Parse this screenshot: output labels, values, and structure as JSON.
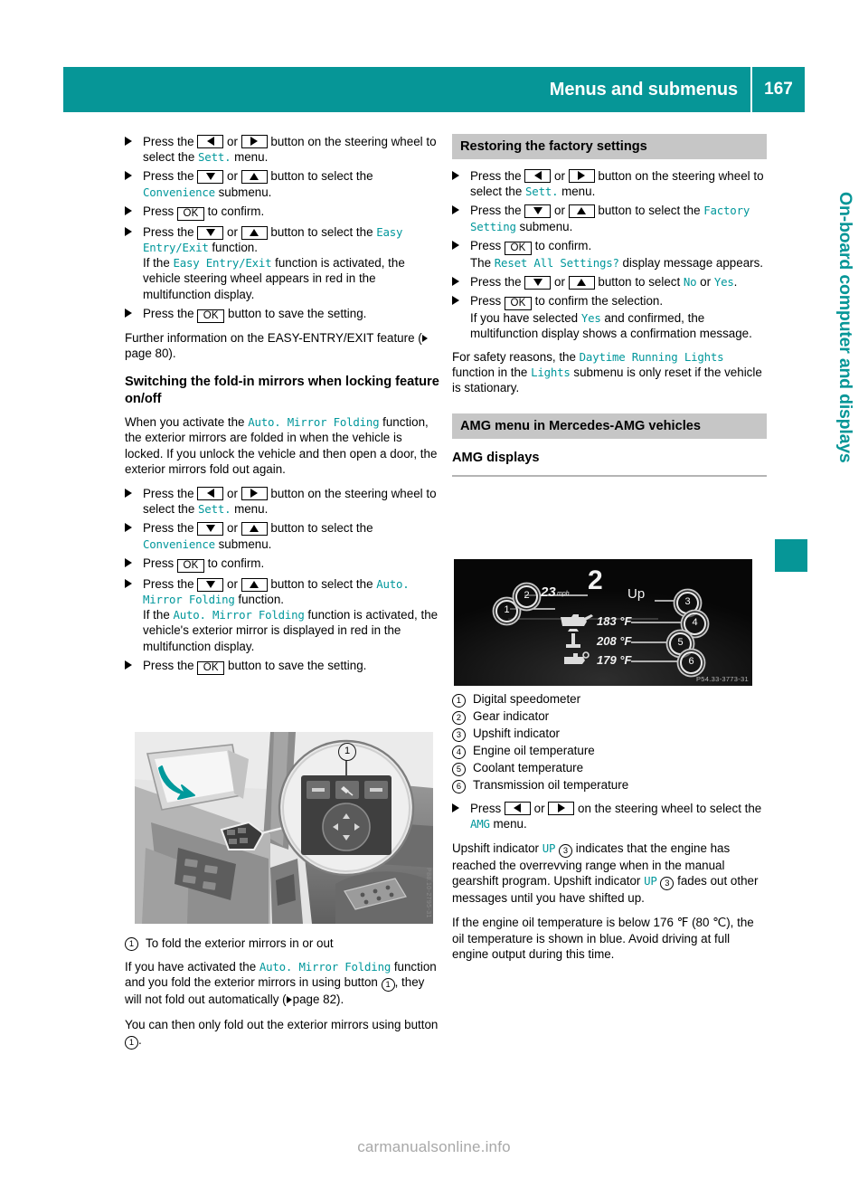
{
  "header": {
    "title": "Menus and submenus",
    "page_number": "167"
  },
  "side_tab": {
    "label": "On-board computer and displays"
  },
  "keys": {
    "left": "left-arrow",
    "right": "right-arrow",
    "up": "up-arrow",
    "down": "down-arrow",
    "ok": "OK"
  },
  "left_column": {
    "steps_easy_entry": [
      {
        "parts": [
          "Press the ",
          "KEY_LEFT",
          " or ",
          "KEY_RIGHT",
          " button on the steering wheel to select the ",
          "DISP:Sett.",
          " menu."
        ]
      },
      {
        "parts": [
          "Press the ",
          "KEY_DOWN",
          " or ",
          "KEY_UP",
          " button to select the ",
          "DISP:Convenience",
          " submenu."
        ]
      },
      {
        "parts": [
          "Press ",
          "KEY_OK",
          " to confirm."
        ]
      },
      {
        "parts": [
          "Press the ",
          "KEY_DOWN",
          " or ",
          "KEY_UP",
          " button to select the ",
          "DISP:Easy Entry/Exit",
          " function.",
          "BR",
          "If the ",
          "DISP:Easy Entry/Exit",
          " function is activated, the vehicle steering wheel appears in red in the multifunction display."
        ]
      },
      {
        "parts": [
          "Press the ",
          "KEY_OK",
          " button to save the setting."
        ]
      }
    ],
    "further_info": {
      "text_before": "Further information on the EASY-ENTRY/EXIT feature (",
      "page_ref": "page 80",
      "text_after": ")."
    },
    "fold_in_heading": "Switching the fold-in mirrors when locking feature on/off",
    "fold_in_intro": {
      "before": "When you activate the ",
      "display": "Auto. Mirror Folding",
      "after": " function, the exterior mirrors are folded in when the vehicle is locked. If you unlock the vehicle and then open a door, the exterior mirrors fold out again."
    },
    "steps_mirror_folding": [
      {
        "parts": [
          "Press the ",
          "KEY_LEFT",
          " or ",
          "KEY_RIGHT",
          " button on the steering wheel to select the ",
          "DISP:Sett.",
          " menu."
        ]
      },
      {
        "parts": [
          "Press the ",
          "KEY_DOWN",
          " or ",
          "KEY_UP",
          " button to select the ",
          "DISP:Convenience",
          " submenu."
        ]
      },
      {
        "parts": [
          "Press ",
          "KEY_OK",
          " to confirm."
        ]
      },
      {
        "parts": [
          "Press the ",
          "KEY_DOWN",
          " or ",
          "KEY_UP",
          " button to select the ",
          "DISP:Auto. Mirror Folding",
          " function.",
          "BR",
          "If the ",
          "DISP:Auto. Mirror Folding",
          " function is activated, the vehicle's exterior mirror is displayed in red in the multifunction display."
        ]
      },
      {
        "parts": [
          "Press the ",
          "KEY_OK",
          " button to save the setting."
        ]
      }
    ],
    "photo_caption": {
      "marker": "1",
      "text": "To fold the exterior mirrors in or out"
    },
    "photo_note_1": {
      "before": "If you have activated the ",
      "display": "Auto. Mirror Folding",
      "middle": " function and you fold the exterior mirrors in using button ",
      "marker": "1",
      "middle2": ", they will not fold out automatically (",
      "page_ref": "page 82",
      "after": ")."
    },
    "photo_note_2": {
      "before": "You can then only fold out the exterior mirrors using button ",
      "marker": "1",
      "after": "."
    }
  },
  "right_column": {
    "factory_heading": "Restoring the factory settings",
    "steps_factory": [
      {
        "parts": [
          "Press the ",
          "KEY_LEFT",
          " or ",
          "KEY_RIGHT",
          " button on the steering wheel to select the ",
          "DISP:Sett.",
          " menu."
        ]
      },
      {
        "parts": [
          "Press the ",
          "KEY_DOWN",
          " or ",
          "KEY_UP",
          " button to select the ",
          "DISP:Factory Setting",
          " submenu."
        ]
      },
      {
        "parts": [
          "Press ",
          "KEY_OK",
          " to confirm.",
          "BR",
          "The ",
          "DISP:Reset All Settings?",
          " display message appears."
        ]
      },
      {
        "parts": [
          "Press the ",
          "KEY_DOWN",
          " or ",
          "KEY_UP",
          " button to select ",
          "DISP:No",
          " or ",
          "DISP:Yes",
          "."
        ]
      },
      {
        "parts": [
          "Press ",
          "KEY_OK",
          " to confirm the selection.",
          "BR",
          "If you have selected ",
          "DISP:Yes",
          " and confirmed, the multifunction display shows a confirmation message."
        ]
      }
    ],
    "safety_note": {
      "before": "For safety reasons, the ",
      "display1": "Daytime Running Lights",
      "middle": " function in the ",
      "display2": "Lights",
      "after": " submenu is only reset if the vehicle is stationary."
    },
    "amg_heading": "AMG menu in Mercedes-AMG vehicles",
    "amg_displays_heading": "AMG displays",
    "amg_legend": [
      {
        "marker": "1",
        "label": "Digital speedometer"
      },
      {
        "marker": "2",
        "label": "Gear indicator"
      },
      {
        "marker": "3",
        "label": "Upshift indicator"
      },
      {
        "marker": "4",
        "label": "Engine oil temperature"
      },
      {
        "marker": "5",
        "label": "Coolant temperature"
      },
      {
        "marker": "6",
        "label": "Transmission oil temperature"
      }
    ],
    "amg_step": {
      "parts": [
        "Press ",
        "KEY_LEFT",
        " or ",
        "KEY_RIGHT",
        " on the steering wheel to select the ",
        "DISP:AMG",
        " menu."
      ]
    },
    "upshift_note": {
      "before": "Upshift indicator ",
      "display1": "UP",
      "marker1": "3",
      "middle": " indicates that the engine has reached the overrevving range when in the manual gearshift program. Upshift indicator ",
      "display2": "UP",
      "marker2": "3",
      "after": " fades out other messages until you have shifted up."
    },
    "oil_temp_note": "If the engine oil temperature is below 176 ℉ (80 ℃), the oil temperature is shown in blue. Avoid driving at full engine output during this time."
  },
  "amg_display_image": {
    "speed_value": "23",
    "speed_unit": "mph",
    "gear": "2",
    "upshift": "Up",
    "engine_oil_temp": "183 °F",
    "coolant_temp": "208 °F",
    "transmission_oil_temp": "179 °F",
    "image_code": "P54.33-3773-31",
    "callouts": [
      "1",
      "2",
      "3",
      "4",
      "5",
      "6"
    ]
  },
  "mirror_image": {
    "callout": "1",
    "image_code": "P88.10-2795-31"
  },
  "footer": {
    "watermark": "carmanualsonline.info"
  },
  "colors": {
    "teal": "#069697",
    "display_teal": "#00979b",
    "gray_heading": "#c6c6c6",
    "watermark_gray": "#a8a8a8"
  }
}
